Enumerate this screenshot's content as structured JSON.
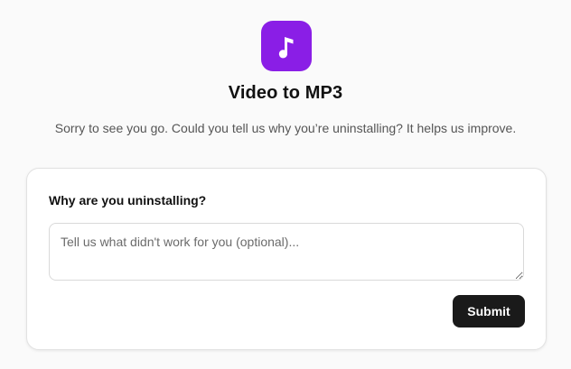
{
  "app": {
    "name": "Video to MP3",
    "icon": "music-note-icon",
    "icon_background": "#8a1ee6"
  },
  "subtitle": "Sorry to see you go. Could you tell us why you’re uninstalling? It helps us improve.",
  "form": {
    "question": "Why are you uninstalling?",
    "feedback_value": "",
    "feedback_placeholder": "Tell us what didn't work for you (optional)...",
    "submit_label": "Submit",
    "submit_color": "#1a1a1a"
  }
}
